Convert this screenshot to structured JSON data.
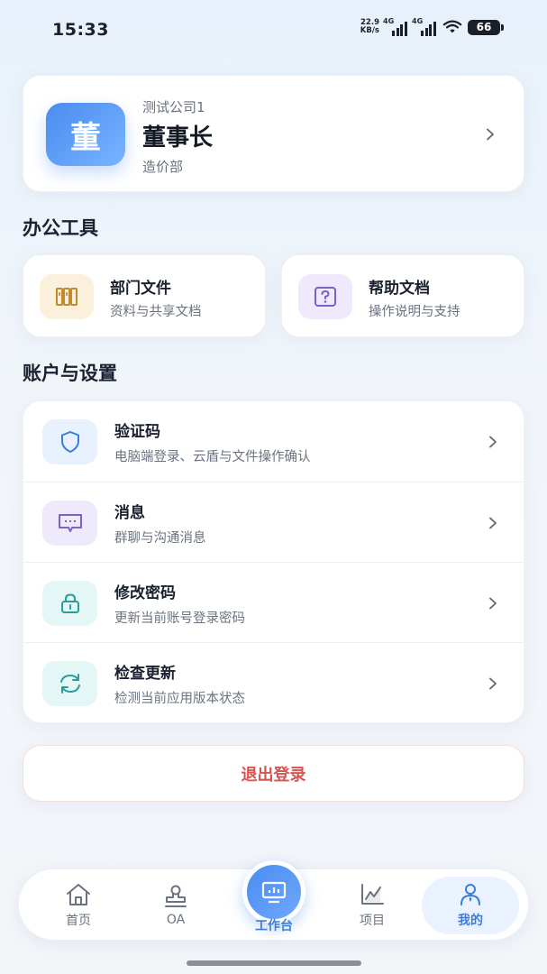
{
  "status_bar": {
    "time": "15:33",
    "net_speed_value": "22.9",
    "net_speed_unit": "KB/s",
    "signal1_label": "4G",
    "signal2_label": "4G",
    "battery": "66"
  },
  "profile": {
    "avatar_char": "董",
    "company": "测试公司1",
    "role": "董事长",
    "department": "造价部"
  },
  "office_tools": {
    "title": "办公工具",
    "items": [
      {
        "title": "部门文件",
        "subtitle": "资料与共享文档",
        "icon": "book-icon",
        "color": "#c08a2e"
      },
      {
        "title": "帮助文档",
        "subtitle": "操作说明与支持",
        "icon": "help-icon",
        "color": "#7b62c9"
      }
    ]
  },
  "account_settings": {
    "title": "账户与设置",
    "items": [
      {
        "title": "验证码",
        "subtitle": "电脑端登录、云盾与文件操作确认",
        "icon": "shield-icon"
      },
      {
        "title": "消息",
        "subtitle": "群聊与沟通消息",
        "icon": "message-icon"
      },
      {
        "title": "修改密码",
        "subtitle": "更新当前账号登录密码",
        "icon": "lock-icon"
      },
      {
        "title": "检查更新",
        "subtitle": "检测当前应用版本状态",
        "icon": "refresh-icon"
      }
    ]
  },
  "logout_label": "退出登录",
  "bottom_nav": {
    "items": [
      {
        "label": "首页",
        "icon": "home-icon"
      },
      {
        "label": "OA",
        "icon": "stamp-icon"
      },
      {
        "label": "工作台",
        "icon": "monitor-icon"
      },
      {
        "label": "项目",
        "icon": "chart-icon"
      },
      {
        "label": "我的",
        "icon": "user-icon"
      }
    ],
    "active": "我的"
  },
  "colors": {
    "accent": "#3b7ddd",
    "logout": "#d9534f"
  }
}
